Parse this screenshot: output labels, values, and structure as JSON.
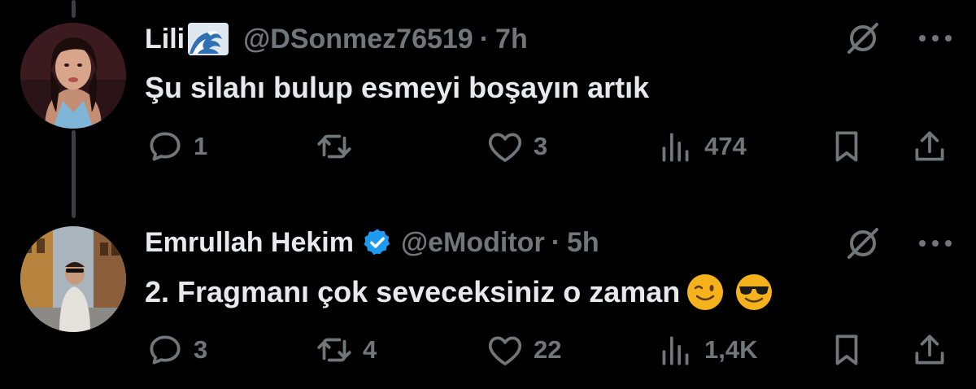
{
  "tweets": [
    {
      "name": "Lili",
      "name_emoji": "water-wave-emoji",
      "handle": "@DSonmez76519",
      "separator": "·",
      "time": "7h",
      "text": "Şu silahı bulup esmeyi boşayın artık",
      "replies": "1",
      "retweets": "",
      "likes": "3",
      "views": "474",
      "verified": false
    },
    {
      "name": "Emrullah Hekim",
      "handle": "@eModitor",
      "separator": "·",
      "time": "5h",
      "text": "2. Fragmanı çok seveceksiniz o zaman",
      "text_emojis": [
        "winking-face-emoji",
        "smiling-face-with-sunglasses-emoji"
      ],
      "replies": "3",
      "retweets": "4",
      "likes": "22",
      "views": "1,4K",
      "verified": true
    }
  ],
  "colors": {
    "background": "#000000",
    "text_primary": "#e7e9ea",
    "text_secondary": "#71767b",
    "verified_blue": "#1d9bf0",
    "thread_line": "#3a3d41"
  },
  "icons": [
    "reply-icon",
    "retweet-icon",
    "like-icon",
    "views-icon",
    "bookmark-icon",
    "share-icon",
    "grok-icon",
    "more-icon"
  ]
}
